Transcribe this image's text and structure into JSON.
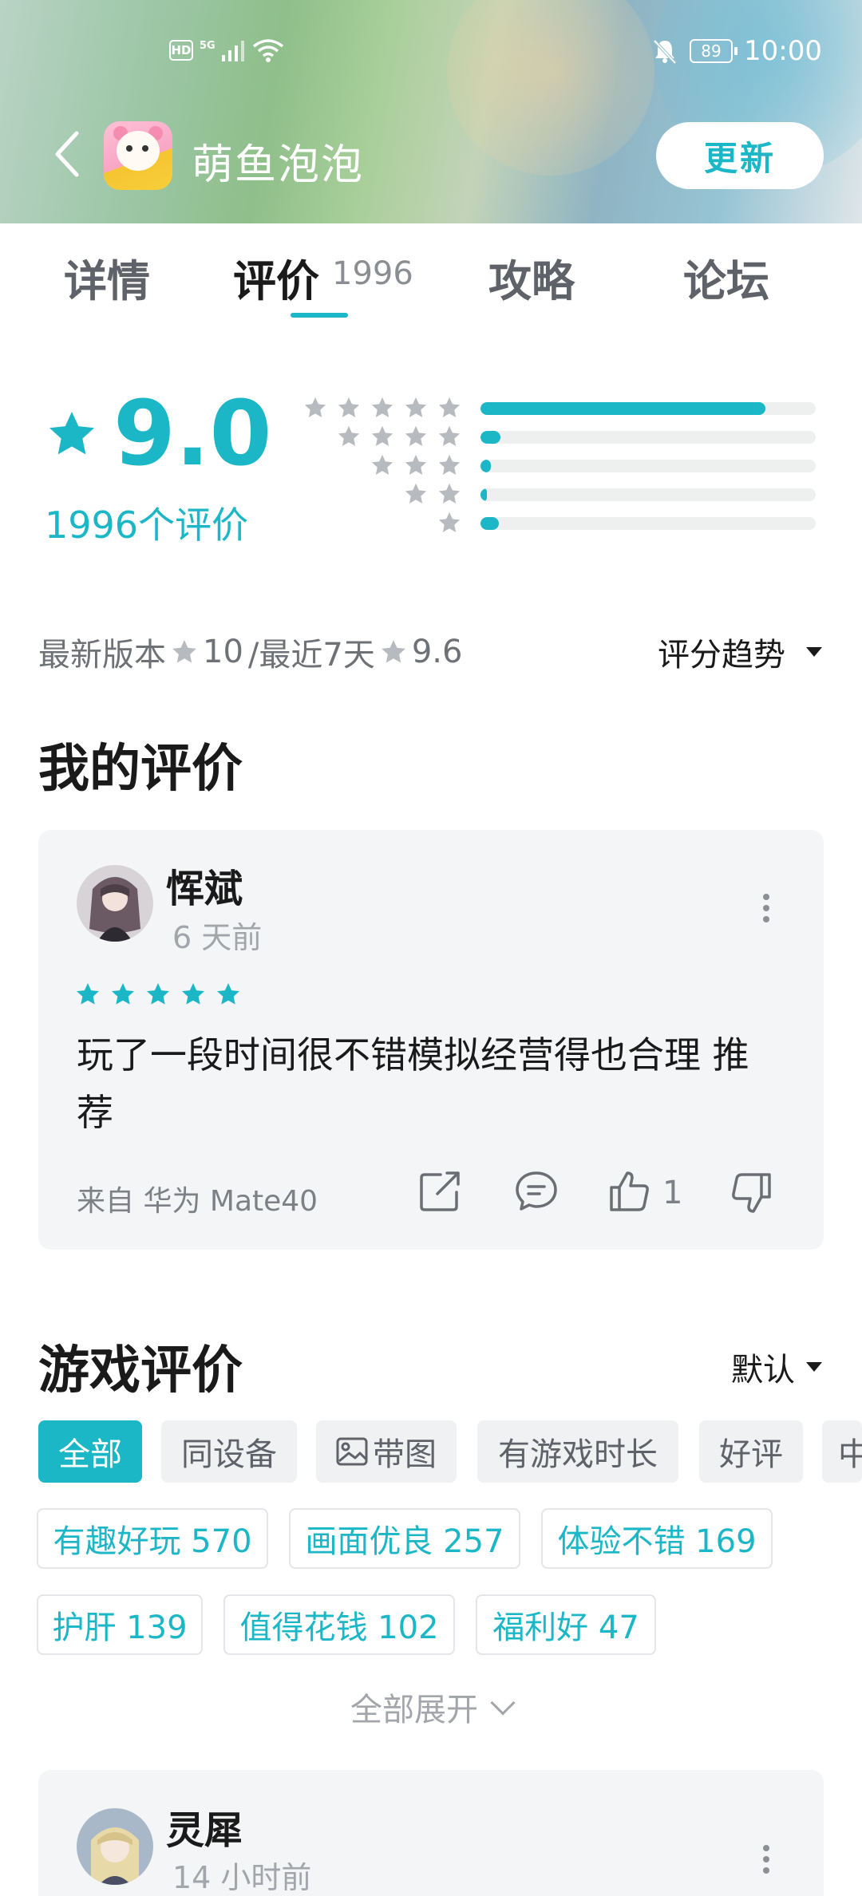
{
  "status_bar": {
    "hd": "HD",
    "signal": "5G",
    "battery": "89",
    "time": "10:00"
  },
  "header": {
    "app_name": "萌鱼泡泡",
    "update_label": "更新"
  },
  "tabs": [
    {
      "label": "详情"
    },
    {
      "label": "评价",
      "count": "1996",
      "active": true
    },
    {
      "label": "攻略"
    },
    {
      "label": "论坛"
    }
  ],
  "rating": {
    "score": "9.0",
    "count_text": "1996个评价",
    "distribution": [
      {
        "stars": 5,
        "fraction": 0.85
      },
      {
        "stars": 4,
        "fraction": 0.06
      },
      {
        "stars": 3,
        "fraction": 0.03
      },
      {
        "stars": 2,
        "fraction": 0.015
      },
      {
        "stars": 1,
        "fraction": 0.055
      }
    ],
    "version_label": "最新版本",
    "version_score": "10",
    "recent_label": "/最近7天",
    "recent_score": "9.6",
    "trend_label": "评分趋势"
  },
  "my_review": {
    "section_title": "我的评价",
    "username": "恽斌",
    "time": "6 天前",
    "stars": 5,
    "text_line1": "玩了一段时间很不错模拟经营得也合理 推",
    "text_line2": "荐",
    "device": "来自 华为 Mate40",
    "likes": "1"
  },
  "game_reviews": {
    "section_title": "游戏评价",
    "sort_label": "默认",
    "filters": [
      "全部",
      "同设备",
      "带图",
      "有游戏时长",
      "好评",
      "中"
    ],
    "tags": [
      "有趣好玩 570",
      "画面优良 257",
      "体验不错 169",
      "护肝 139",
      "值得花钱 102",
      "福利好 47"
    ],
    "expand_label": "全部展开"
  },
  "second_review": {
    "username": "灵犀",
    "time": "14 小时前"
  },
  "colors": {
    "accent": "#1bb7c6",
    "star_gray": "#b7babe",
    "card_bg": "#f4f5f6"
  }
}
